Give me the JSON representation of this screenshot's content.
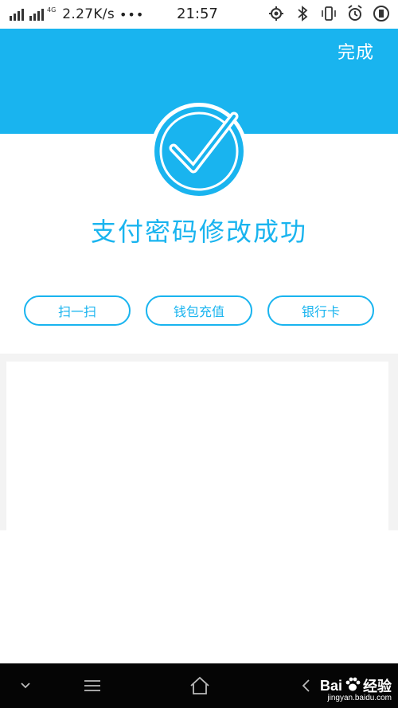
{
  "status_bar": {
    "network_tag_1": "4G",
    "network_speed": "2.27K/s",
    "more_indicator": "•••",
    "time": "21:57",
    "icons": [
      "location-icon",
      "bluetooth-icon",
      "vibrate-icon",
      "alarm-icon",
      "battery-icon"
    ]
  },
  "header": {
    "done_label": "完成"
  },
  "result": {
    "title": "支付密码修改成功"
  },
  "actions": [
    {
      "label": "扫一扫"
    },
    {
      "label": "钱包充值"
    },
    {
      "label": "银行卡"
    }
  ],
  "watermark": {
    "brand_latin": "Bai",
    "brand_cn": "经验",
    "url": "jingyan.baidu.com"
  },
  "colors": {
    "accent": "#19b4ef",
    "nav_bar": "#050505"
  }
}
